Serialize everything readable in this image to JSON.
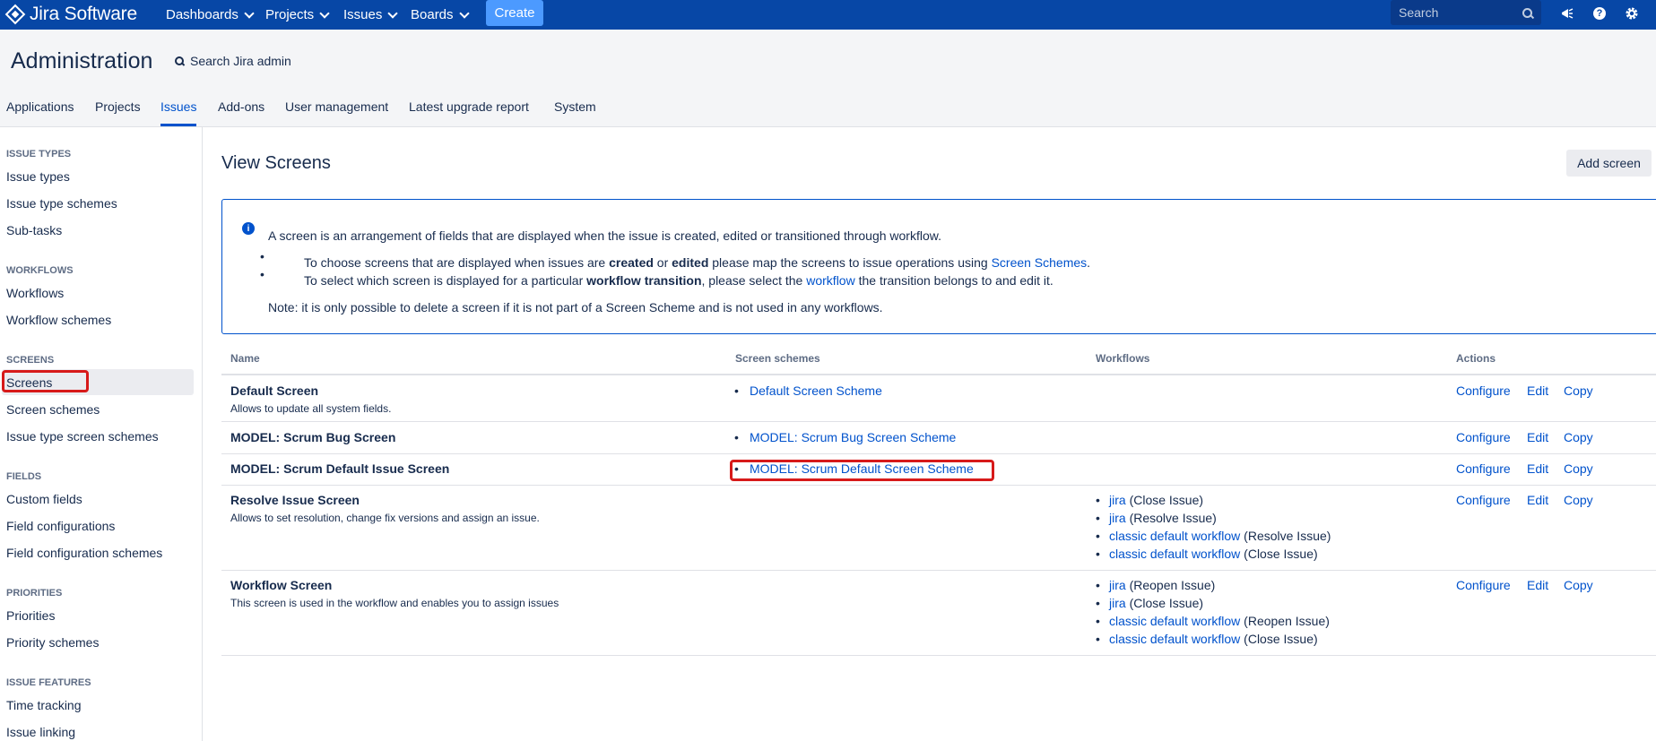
{
  "topnav": {
    "brand": "Jira Software",
    "items": [
      {
        "label": "Dashboards"
      },
      {
        "label": "Projects"
      },
      {
        "label": "Issues"
      },
      {
        "label": "Boards"
      }
    ],
    "create_label": "Create",
    "search_placeholder": "Search",
    "colors": {
      "bar": "#0747a6",
      "create": "#4c9aff"
    }
  },
  "admin": {
    "title": "Administration",
    "search_label": "Search Jira admin",
    "tabs": [
      {
        "label": "Applications"
      },
      {
        "label": "Projects"
      },
      {
        "label": "Issues",
        "active": true
      },
      {
        "label": "Add-ons"
      },
      {
        "label": "User management"
      },
      {
        "label": "Latest upgrade report"
      },
      {
        "label": "System"
      }
    ]
  },
  "sidebar": {
    "sections": [
      {
        "heading": "ISSUE TYPES",
        "items": [
          "Issue types",
          "Issue type schemes",
          "Sub-tasks"
        ]
      },
      {
        "heading": "WORKFLOWS",
        "items": [
          "Workflows",
          "Workflow schemes"
        ]
      },
      {
        "heading": "SCREENS",
        "items": [
          "Screens",
          "Screen schemes",
          "Issue type screen schemes"
        ]
      },
      {
        "heading": "FIELDS",
        "items": [
          "Custom fields",
          "Field configurations",
          "Field configuration schemes"
        ]
      },
      {
        "heading": "PRIORITIES",
        "items": [
          "Priorities",
          "Priority schemes"
        ]
      },
      {
        "heading": "ISSUE FEATURES",
        "items": [
          "Time tracking",
          "Issue linking"
        ]
      }
    ],
    "selected": "Screens"
  },
  "main": {
    "title": "View Screens",
    "add_button": "Add screen",
    "info": {
      "intro": "A screen is an arrangement of fields that are displayed when the issue is created, edited or transitioned through workflow.",
      "b1_p1": "To choose screens that are displayed when issues are ",
      "b1_bold1": "created",
      "b1_p2": " or ",
      "b1_bold2": "edited",
      "b1_p3": " please map the screens to issue operations using ",
      "b1_link": "Screen Schemes",
      "b1_p4": ".",
      "b2_p1": "To select which screen is displayed for a particular ",
      "b2_bold": "workflow transition",
      "b2_p2": ", please select the ",
      "b2_link": "workflow",
      "b2_p3": " the transition belongs to and edit it.",
      "note": "Note: it is only possible to delete a screen if it is not part of a Screen Scheme and is not used in any workflows."
    },
    "table": {
      "headers": {
        "name": "Name",
        "schemes": "Screen schemes",
        "workflows": "Workflows",
        "actions": "Actions"
      },
      "actions": {
        "configure": "Configure",
        "edit": "Edit",
        "copy": "Copy"
      },
      "rows": [
        {
          "name": "Default Screen",
          "desc": "Allows to update all system fields.",
          "scheme": "Default Screen Scheme",
          "workflows": []
        },
        {
          "name": "MODEL: Scrum Bug Screen",
          "desc": "",
          "scheme": "MODEL: Scrum Bug Screen Scheme",
          "workflows": []
        },
        {
          "name": "MODEL: Scrum Default Issue Screen",
          "desc": "",
          "scheme": "MODEL: Scrum Default Screen Scheme",
          "workflows": []
        },
        {
          "name": "Resolve Issue Screen",
          "desc": "Allows to set resolution, change fix versions and assign an issue.",
          "scheme": "",
          "workflows": [
            {
              "link": "jira",
              "transition": "(Close Issue)"
            },
            {
              "link": "jira",
              "transition": "(Resolve Issue)"
            },
            {
              "link": "classic default workflow",
              "transition": "(Resolve Issue)"
            },
            {
              "link": "classic default workflow",
              "transition": "(Close Issue)"
            }
          ]
        },
        {
          "name": "Workflow Screen",
          "desc": "This screen is used in the workflow and enables you to assign issues",
          "scheme": "",
          "workflows": [
            {
              "link": "jira",
              "transition": "(Reopen Issue)"
            },
            {
              "link": "jira",
              "transition": "(Close Issue)"
            },
            {
              "link": "classic default workflow",
              "transition": "(Reopen Issue)"
            },
            {
              "link": "classic default workflow",
              "transition": "(Close Issue)"
            }
          ]
        }
      ]
    },
    "highlight_color": "#d71a1a"
  }
}
